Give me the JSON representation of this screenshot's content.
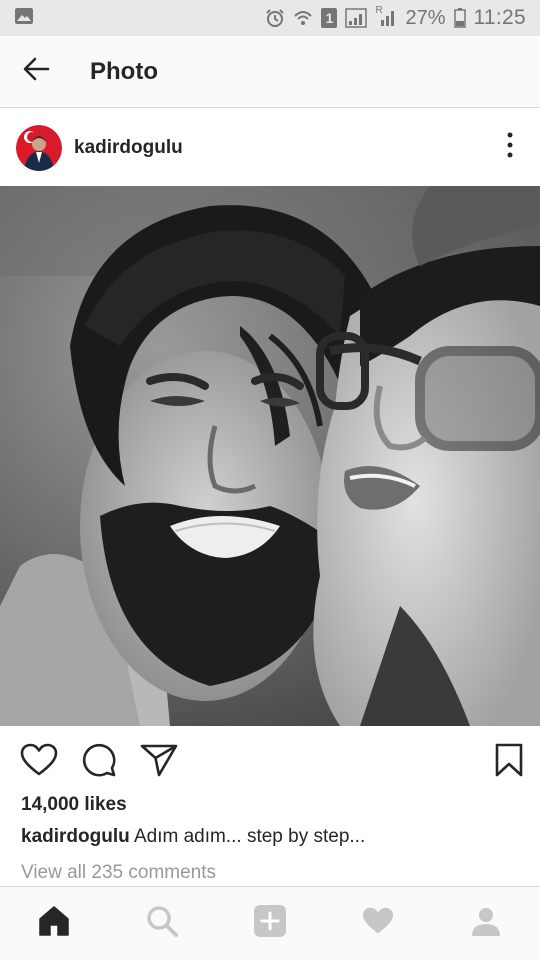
{
  "status_bar": {
    "battery_percent": "27%",
    "time": "11:25",
    "sim_badge": "1",
    "roaming_label": "R",
    "icons": [
      "gallery-icon",
      "alarm-icon",
      "wifi-icon",
      "sim-icon",
      "signal-icon",
      "signal-roaming-icon",
      "battery-icon"
    ]
  },
  "app_bar": {
    "title": "Photo",
    "back_icon": "arrow-left-icon"
  },
  "post": {
    "username": "kadirdogulu",
    "more_icon": "more-vertical-icon",
    "photo_icon": "photo-image",
    "likes": "14,000 likes",
    "caption_user": "kadirdogulu",
    "caption_text": " Adım adım... step by step...",
    "view_comments": "View all 235 comments"
  },
  "actions": {
    "icons": [
      "heart-icon",
      "comment-icon",
      "share-icon",
      "bookmark-icon"
    ]
  },
  "bottom_nav": {
    "items": [
      "home-icon",
      "search-icon",
      "add-post-icon",
      "activity-icon",
      "profile-icon"
    ]
  },
  "colors": {
    "text": "#262626",
    "muted": "#999999",
    "status_bar": "#e8e8e8",
    "border": "#dbdbdb",
    "inactive_nav": "#c7c7c7"
  }
}
